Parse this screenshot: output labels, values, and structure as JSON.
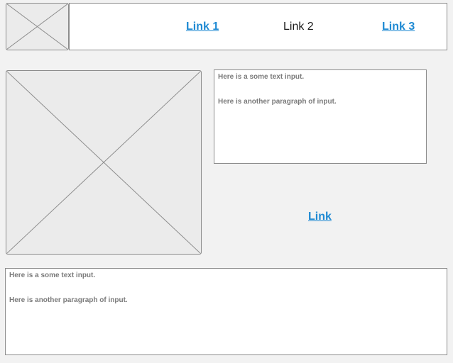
{
  "header": {
    "logo_icon": "image-placeholder-icon",
    "nav": {
      "link1": "Link 1",
      "link2": "Link 2",
      "link3": "Link 3"
    }
  },
  "main": {
    "image_icon": "image-placeholder-icon",
    "text_panel": {
      "p1": "Here is a some text input.",
      "p2": "Here is another paragraph of input."
    },
    "link": "Link"
  },
  "footer_text": {
    "p1": "Here is a some text input.",
    "p2": "Here is another paragraph of input."
  },
  "colors": {
    "background": "#f2f2f2",
    "link": "#1f8ad3",
    "border": "#8c8c8c",
    "placeholder_fill": "#ebebeb",
    "text_gray": "#7a7a7a"
  }
}
